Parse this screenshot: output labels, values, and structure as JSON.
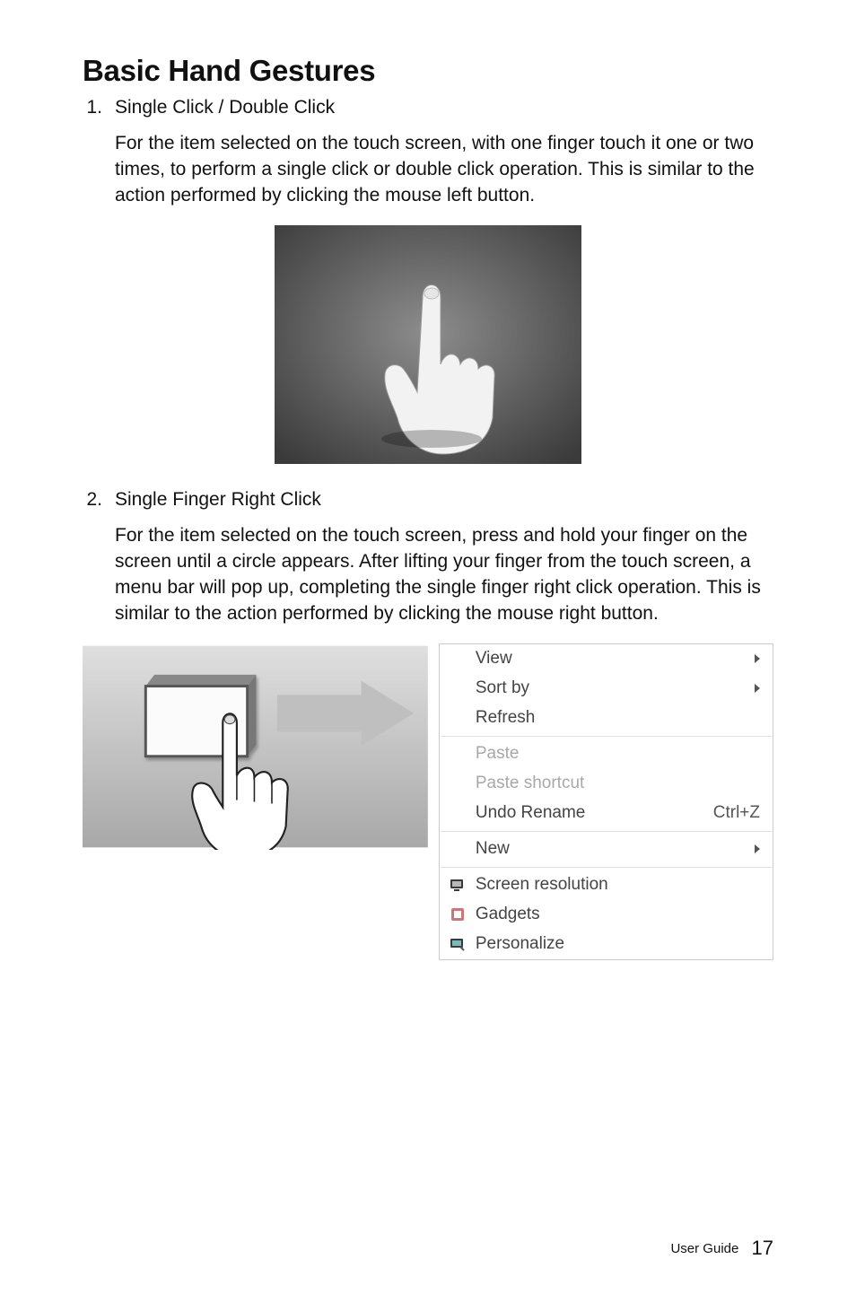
{
  "heading": "Basic Hand Gestures",
  "items": [
    {
      "num": "1.",
      "title": "Single Click / Double Click",
      "para": "For the item selected on the touch screen, with one finger touch it one or two times, to perform a single click or double click operation. This is similar to the action performed by clicking the mouse left button."
    },
    {
      "num": "2.",
      "title": "Single Finger Right Click",
      "para": "For the item selected on the touch screen, press and hold your finger on the screen until a circle appears. After lifting your finger from the touch screen, a menu bar will pop up, completing the single finger right click operation. This is similar to the action performed by clicking the mouse right button."
    }
  ],
  "context_menu": {
    "group1": [
      {
        "label": "View",
        "submenu": true
      },
      {
        "label": "Sort by",
        "submenu": true
      },
      {
        "label": "Refresh"
      }
    ],
    "group2": [
      {
        "label": "Paste",
        "disabled": true
      },
      {
        "label": "Paste shortcut",
        "disabled": true
      },
      {
        "label": "Undo Rename",
        "shortcut": "Ctrl+Z"
      }
    ],
    "group3": [
      {
        "label": "New",
        "submenu": true
      }
    ],
    "group4": [
      {
        "label": "Screen resolution",
        "icon": "screen-res"
      },
      {
        "label": "Gadgets",
        "icon": "gadgets"
      },
      {
        "label": "Personalize",
        "icon": "personalize"
      }
    ]
  },
  "footer": {
    "label": "User Guide",
    "page": "17"
  }
}
